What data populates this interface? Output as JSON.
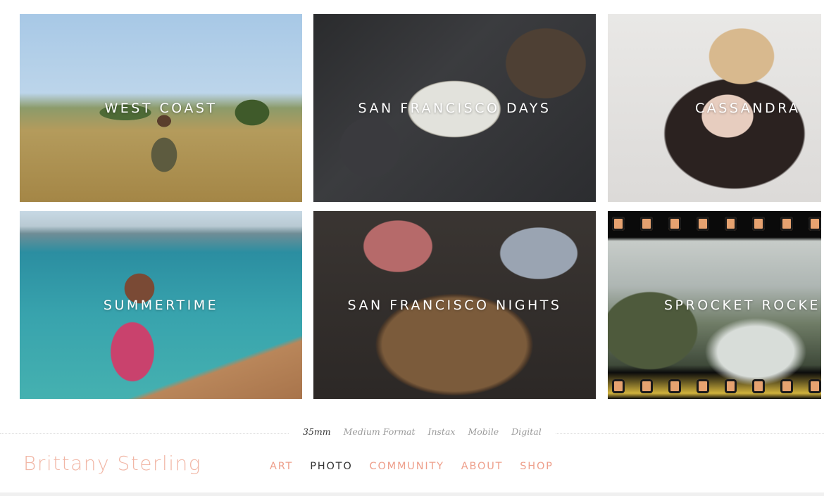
{
  "gallery": {
    "albums": [
      {
        "title": "WEST COAST"
      },
      {
        "title": "SAN FRANCISCO DAYS"
      },
      {
        "title": "CASSANDRA"
      },
      {
        "title": "SUMMERTIME"
      },
      {
        "title": "SAN FRANCISCO NIGHTS"
      },
      {
        "title": "SPROCKET ROCKE"
      }
    ]
  },
  "subnav": {
    "items": [
      "35mm",
      "Medium Format",
      "Instax",
      "Mobile",
      "Digital"
    ],
    "active": "35mm"
  },
  "footer": {
    "brand": "Brittany Sterling",
    "nav": [
      "ART",
      "PHOTO",
      "COMMUNITY",
      "ABOUT",
      "SHOP"
    ],
    "active": "PHOTO"
  },
  "colors": {
    "brand": "#f1b6a5",
    "nav_link": "#ee9f8b",
    "active_text": "#333333",
    "subnav_text": "#9a9a9a"
  }
}
